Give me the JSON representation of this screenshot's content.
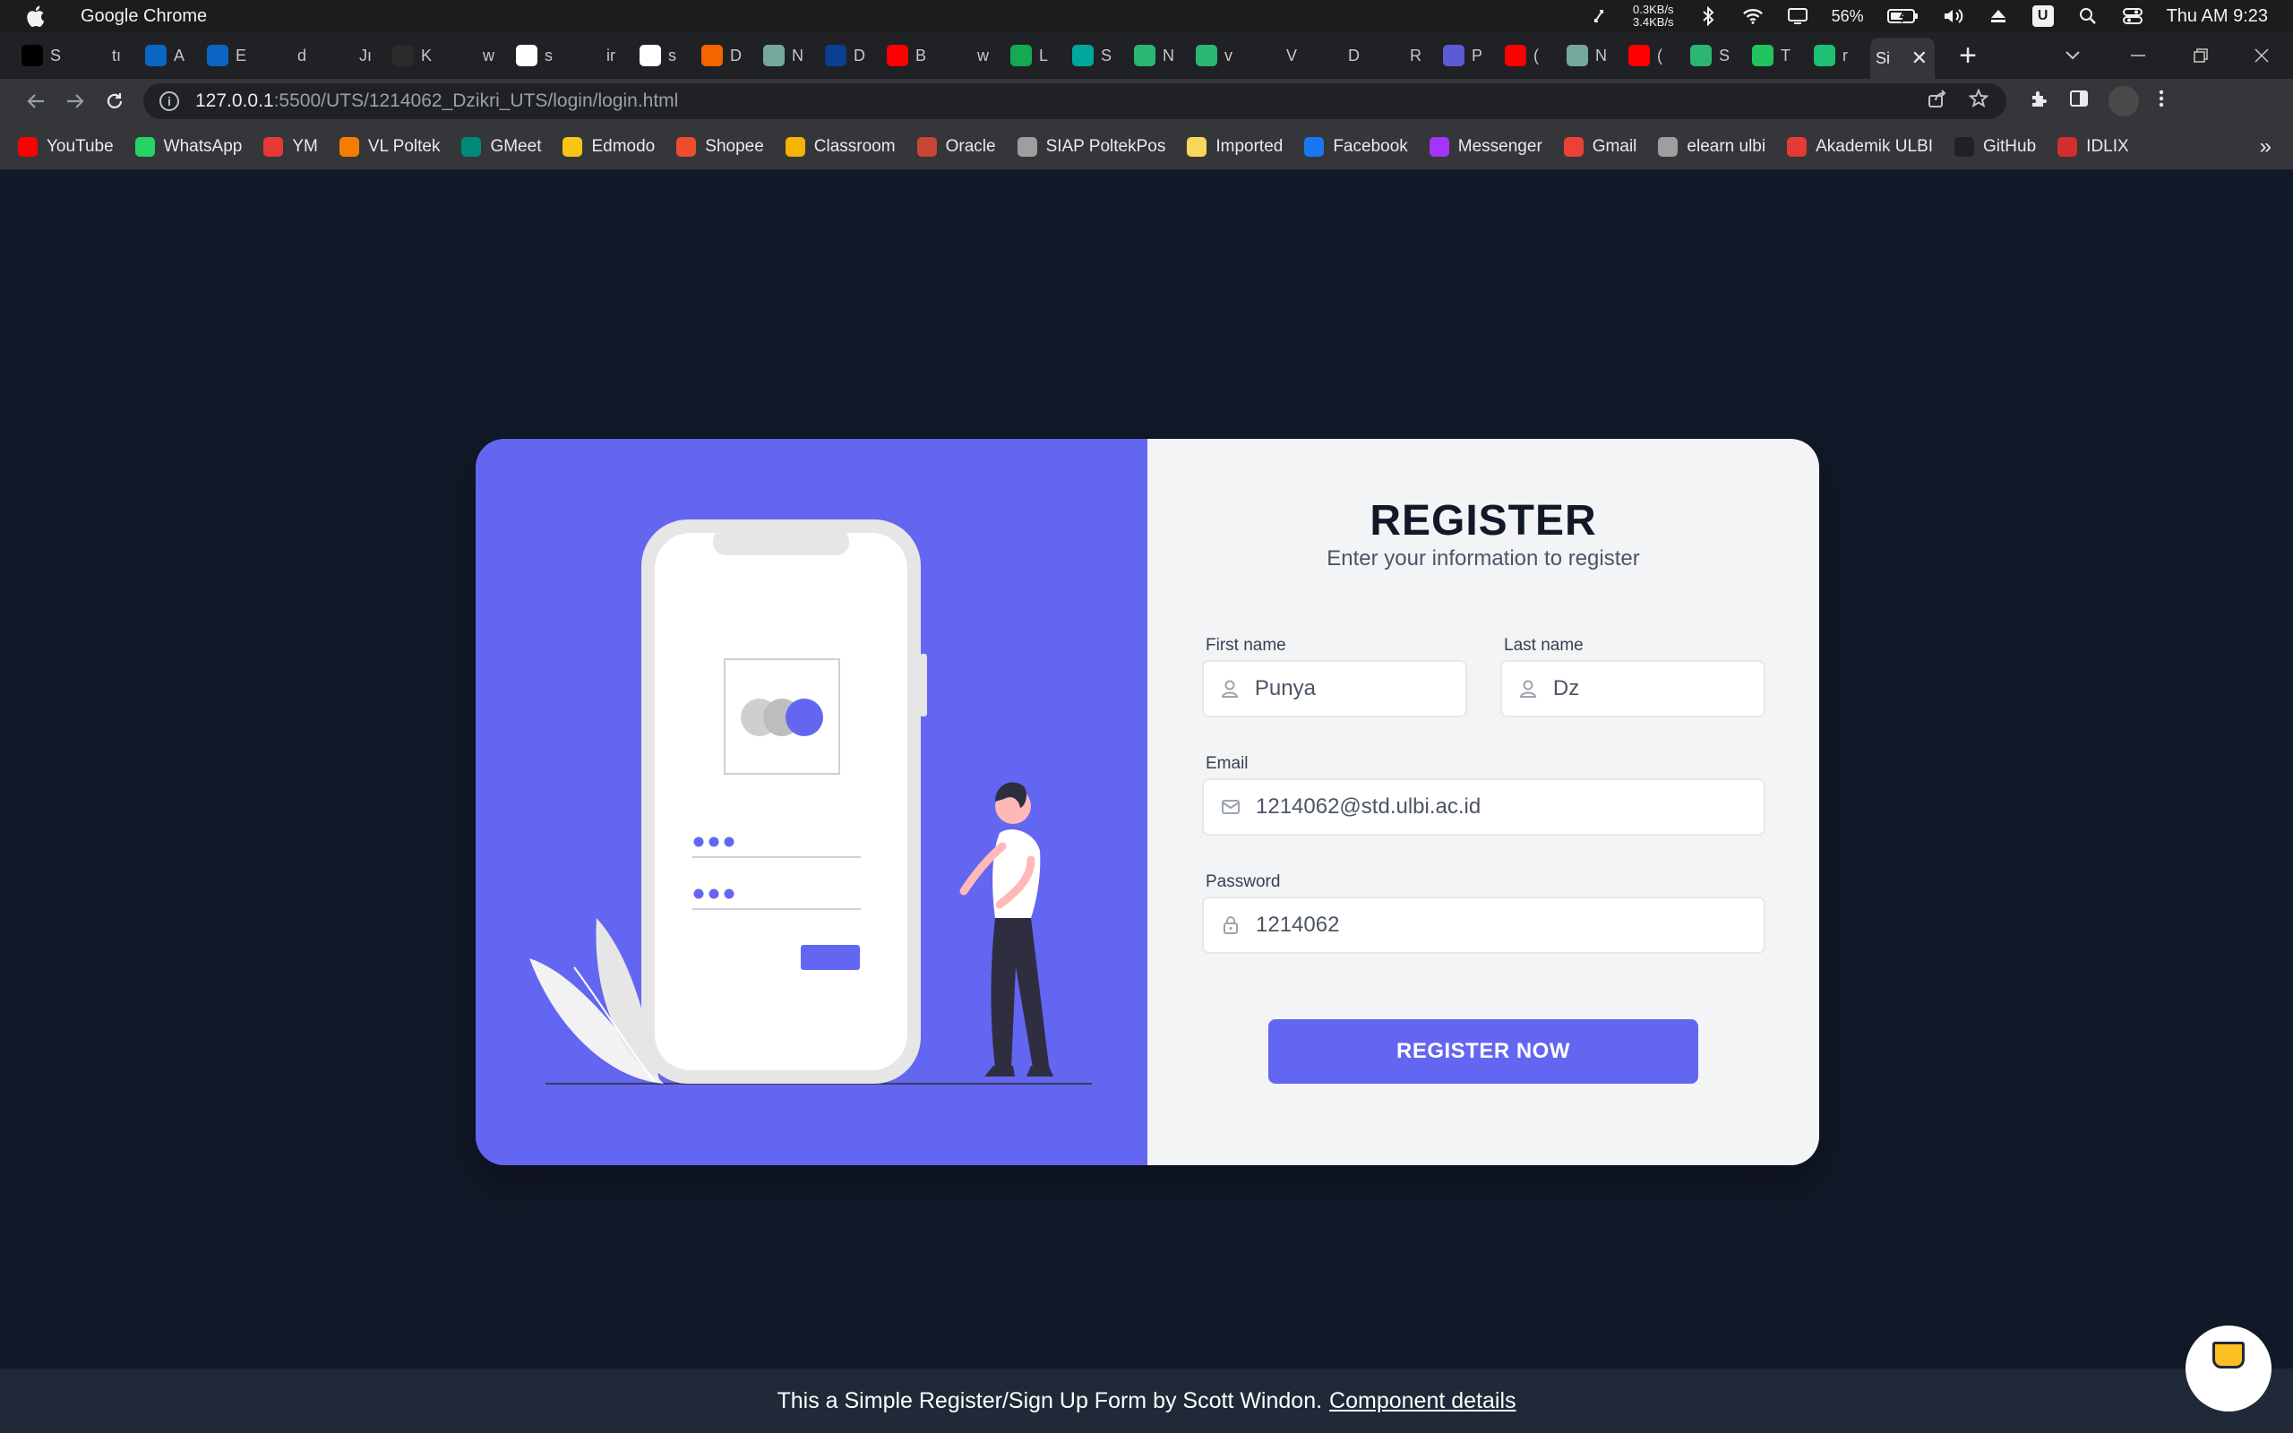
{
  "menubar": {
    "app_name": "Google Chrome",
    "net_up": "0.3KB/s",
    "net_down": "3.4KB/s",
    "battery": "56%",
    "u_badge": "U",
    "clock": "Thu AM 9:23"
  },
  "tabs": [
    {
      "label": "S",
      "icon": "medium-icon",
      "color": "#000000"
    },
    {
      "label": "tı",
      "icon": "github-icon",
      "color": "#202124"
    },
    {
      "label": "A",
      "icon": "linkedin-icon",
      "color": "#0a66c2"
    },
    {
      "label": "E",
      "icon": "linkedin-icon",
      "color": "#0a66c2"
    },
    {
      "label": "d",
      "icon": "github-icon",
      "color": "#202124"
    },
    {
      "label": "Jı",
      "icon": "github-icon",
      "color": "#202124"
    },
    {
      "label": "K",
      "icon": "kaggle-icon",
      "color": "#2a2a2a"
    },
    {
      "label": "w",
      "icon": "github-icon",
      "color": "#202124"
    },
    {
      "label": "s",
      "icon": "google-icon",
      "color": "#ffffff"
    },
    {
      "label": "ir",
      "icon": "github-icon",
      "color": "#202124"
    },
    {
      "label": "s",
      "icon": "google-icon",
      "color": "#ffffff"
    },
    {
      "label": "D",
      "icon": "etsy-icon",
      "color": "#f56400"
    },
    {
      "label": "N",
      "icon": "openai-icon",
      "color": "#74aa9c"
    },
    {
      "label": "D",
      "icon": "docker-icon",
      "color": "#0b3d91"
    },
    {
      "label": "B",
      "icon": "youtube-icon",
      "color": "#ff0000"
    },
    {
      "label": "w",
      "icon": "github-icon",
      "color": "#202124"
    },
    {
      "label": "L",
      "icon": "mongodb-icon",
      "color": "#13aa52"
    },
    {
      "label": "S",
      "icon": "diamond-icon",
      "color": "#00a79d"
    },
    {
      "label": "N",
      "icon": "leaf-icon",
      "color": "#2bb673"
    },
    {
      "label": "v",
      "icon": "leaf-icon",
      "color": "#2bb673"
    },
    {
      "label": "V",
      "icon": "github-icon",
      "color": "#202124"
    },
    {
      "label": "D",
      "icon": "github-icon",
      "color": "#202124"
    },
    {
      "label": "R",
      "icon": "github-icon",
      "color": "#202124"
    },
    {
      "label": "P",
      "icon": "rocket-icon",
      "color": "#5b5bd6"
    },
    {
      "label": "(",
      "icon": "youtube-icon",
      "color": "#ff0000"
    },
    {
      "label": "N",
      "icon": "openai-icon",
      "color": "#74aa9c"
    },
    {
      "label": "(",
      "icon": "youtube-icon",
      "color": "#ff0000"
    },
    {
      "label": "S",
      "icon": "leaf-icon",
      "color": "#2bb673"
    },
    {
      "label": "T",
      "icon": "p-icon",
      "color": "#21c45d"
    },
    {
      "label": "r",
      "icon": "r-icon",
      "color": "#1dbf73"
    }
  ],
  "active_tab": {
    "label": "Si",
    "close": "✕"
  },
  "address": {
    "host": "127.0.0.1",
    "path": ":5500/UTS/1214062_Dzikri_UTS/login/login.html"
  },
  "bookmarks": [
    {
      "label": "YouTube",
      "icon": "youtube-icon",
      "color": "#ff0000"
    },
    {
      "label": "WhatsApp",
      "icon": "whatsapp-icon",
      "color": "#25d366"
    },
    {
      "label": "YM",
      "icon": "ym-icon",
      "color": "#e53935"
    },
    {
      "label": "VL Poltek",
      "icon": "vl-icon",
      "color": "#f57c00"
    },
    {
      "label": "GMeet",
      "icon": "gmeet-icon",
      "color": "#00897b"
    },
    {
      "label": "Edmodo",
      "icon": "edmodo-icon",
      "color": "#f9c513"
    },
    {
      "label": "Shopee",
      "icon": "shopee-icon",
      "color": "#ee4d2d"
    },
    {
      "label": "Classroom",
      "icon": "classroom-icon",
      "color": "#f4b400"
    },
    {
      "label": "Oracle",
      "icon": "oracle-icon",
      "color": "#c74634"
    },
    {
      "label": "SIAP PoltekPos",
      "icon": "siap-icon",
      "color": "#9e9e9e"
    },
    {
      "label": "Imported",
      "icon": "folder-icon",
      "color": "#f9d65c"
    },
    {
      "label": "Facebook",
      "icon": "facebook-icon",
      "color": "#1877f2"
    },
    {
      "label": "Messenger",
      "icon": "messenger-icon",
      "color": "#a334fa"
    },
    {
      "label": "Gmail",
      "icon": "gmail-icon",
      "color": "#ea4335"
    },
    {
      "label": "elearn ulbi",
      "icon": "elearn-icon",
      "color": "#9e9e9e"
    },
    {
      "label": "Akademik ULBI",
      "icon": "akademik-icon",
      "color": "#e53935"
    },
    {
      "label": "GitHub",
      "icon": "github-icon",
      "color": "#202124"
    },
    {
      "label": "IDLIX",
      "icon": "idlix-icon",
      "color": "#d32f2f"
    }
  ],
  "bookmarks_more": "»",
  "form": {
    "title": "REGISTER",
    "subtitle": "Enter your information to register",
    "first_name_label": "First name",
    "first_name_value": "Punya",
    "last_name_label": "Last name",
    "last_name_value": "Dz",
    "email_label": "Email",
    "email_value": "1214062@std.ulbi.ac.id",
    "password_label": "Password",
    "password_value": "1214062",
    "submit_label": "REGISTER NOW"
  },
  "footer": {
    "text": "This a Simple Register/Sign Up Form by Scott Windon.",
    "link": "Component details"
  },
  "colors": {
    "accent": "#6366f1",
    "page_bg": "#111827",
    "panel_bg": "#f3f4f6"
  }
}
